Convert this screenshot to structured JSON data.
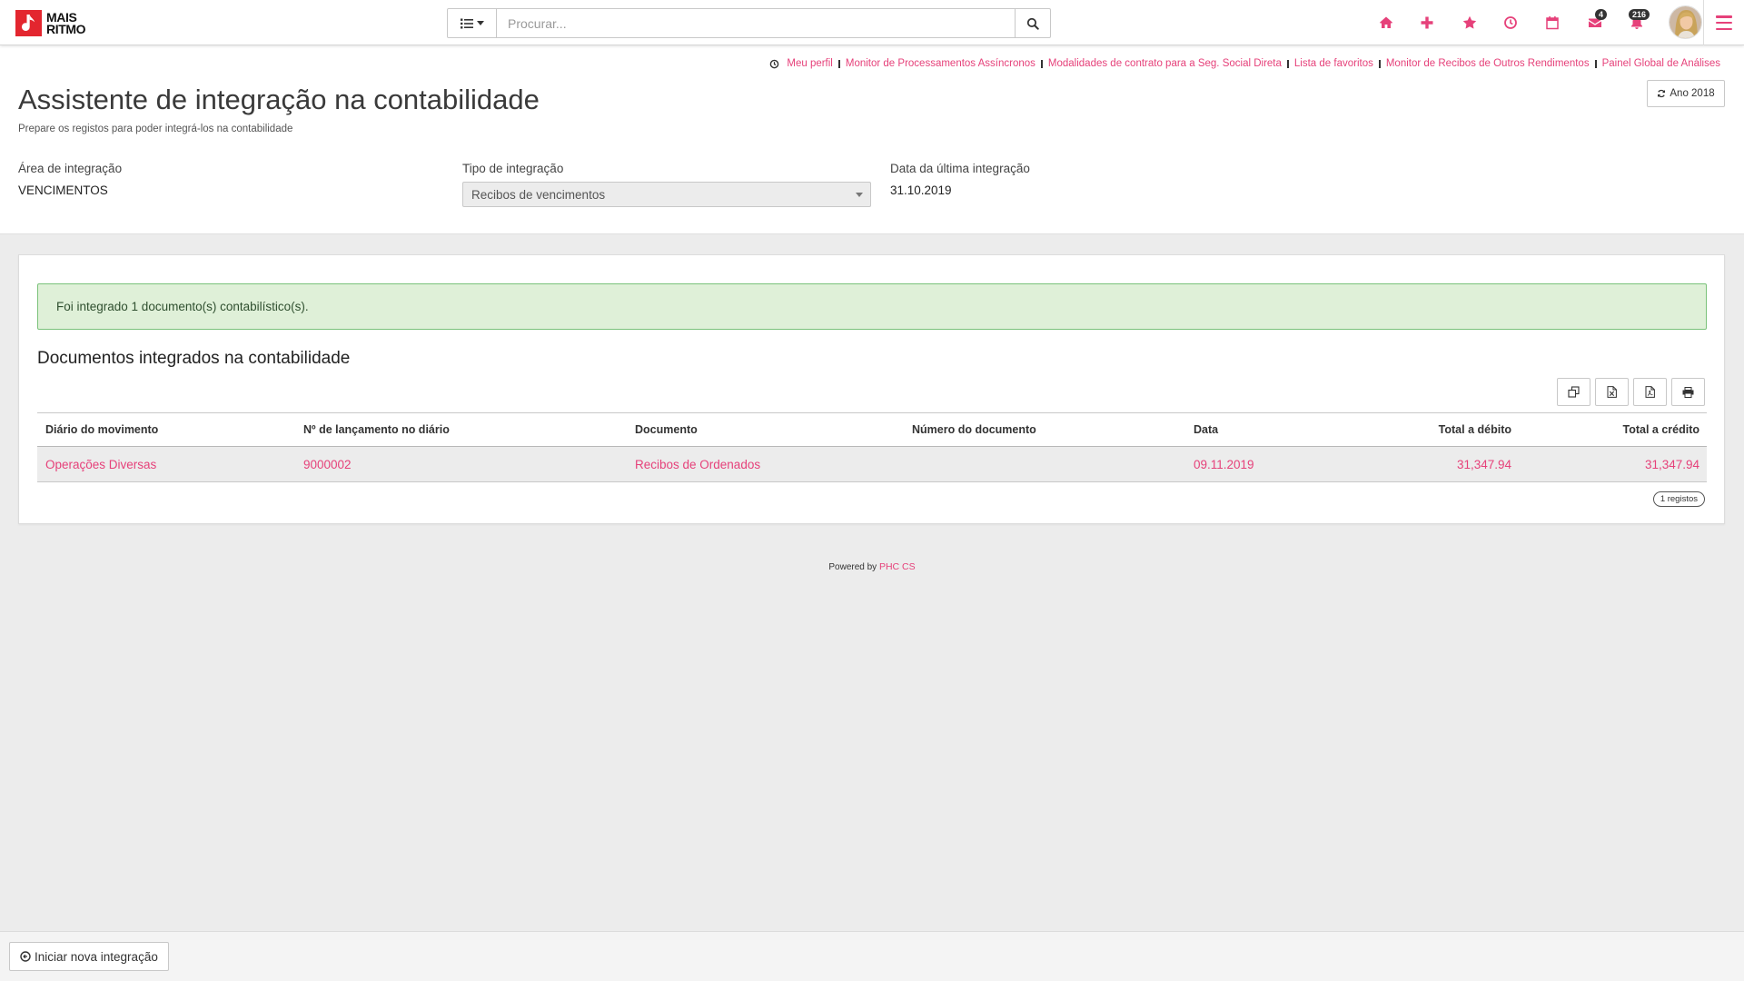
{
  "logo": {
    "line1": "MAIS",
    "line2": "RITMO"
  },
  "search": {
    "placeholder": "Procurar..."
  },
  "navbar": {
    "icons": [
      "home-icon",
      "plus-icon",
      "star-icon",
      "clock-icon",
      "calendar-icon",
      "envelope-icon",
      "bell-icon",
      "hamburger-icon"
    ],
    "messages_badge": "4",
    "notifications_badge": "216"
  },
  "quick_links": [
    "Meu perfil",
    "Monitor de Processamentos Assíncronos",
    "Modalidades de contrato para a Seg. Social Direta",
    "Lista de favoritos",
    "Monitor de Recibos de Outros Rendimentos",
    "Painel Global de Análises"
  ],
  "page": {
    "title": "Assistente de integração na contabilidade",
    "subtitle": "Prepare os registos para poder integrá-los na contabilidade",
    "year_button": "Ano 2018"
  },
  "fields": {
    "area": {
      "label": "Área de integração",
      "value": "VENCIMENTOS"
    },
    "type": {
      "label": "Tipo de integração",
      "value": "Recibos de vencimentos"
    },
    "last_date": {
      "label": "Data da última integração",
      "value": "31.10.2019"
    }
  },
  "alert": {
    "text": "Foi integrado 1 documento(s) contabilístico(s)."
  },
  "documents": {
    "title": "Documentos integrados na contabilidade",
    "toolbar_icons": [
      "copy-icon",
      "excel-icon",
      "pdf-icon",
      "print-icon"
    ],
    "columns": [
      "Diário do movimento",
      "Nº de lançamento no diário",
      "Documento",
      "Número do documento",
      "Data",
      "Total a débito",
      "Total a crédito"
    ],
    "rows": [
      {
        "cells": [
          "Operações Diversas",
          "9000002",
          "Recibos de Ordenados",
          "",
          "09.11.2019",
          "31,347.94",
          "31,347.94"
        ]
      }
    ],
    "record_count": "1 registos"
  },
  "powered_by": {
    "prefix": "Powered by",
    "brand": "PHC CS"
  },
  "footer": {
    "new_integration_button": "Iniciar nova integração"
  },
  "colors": {
    "accent": "#e6417a",
    "logo_red": "#e3262f",
    "page_bg": "#ececec",
    "alert_bg": "#dff0d8",
    "alert_border": "#7ac27a",
    "badge_bg": "#333333",
    "row_bg": "#ececec"
  }
}
